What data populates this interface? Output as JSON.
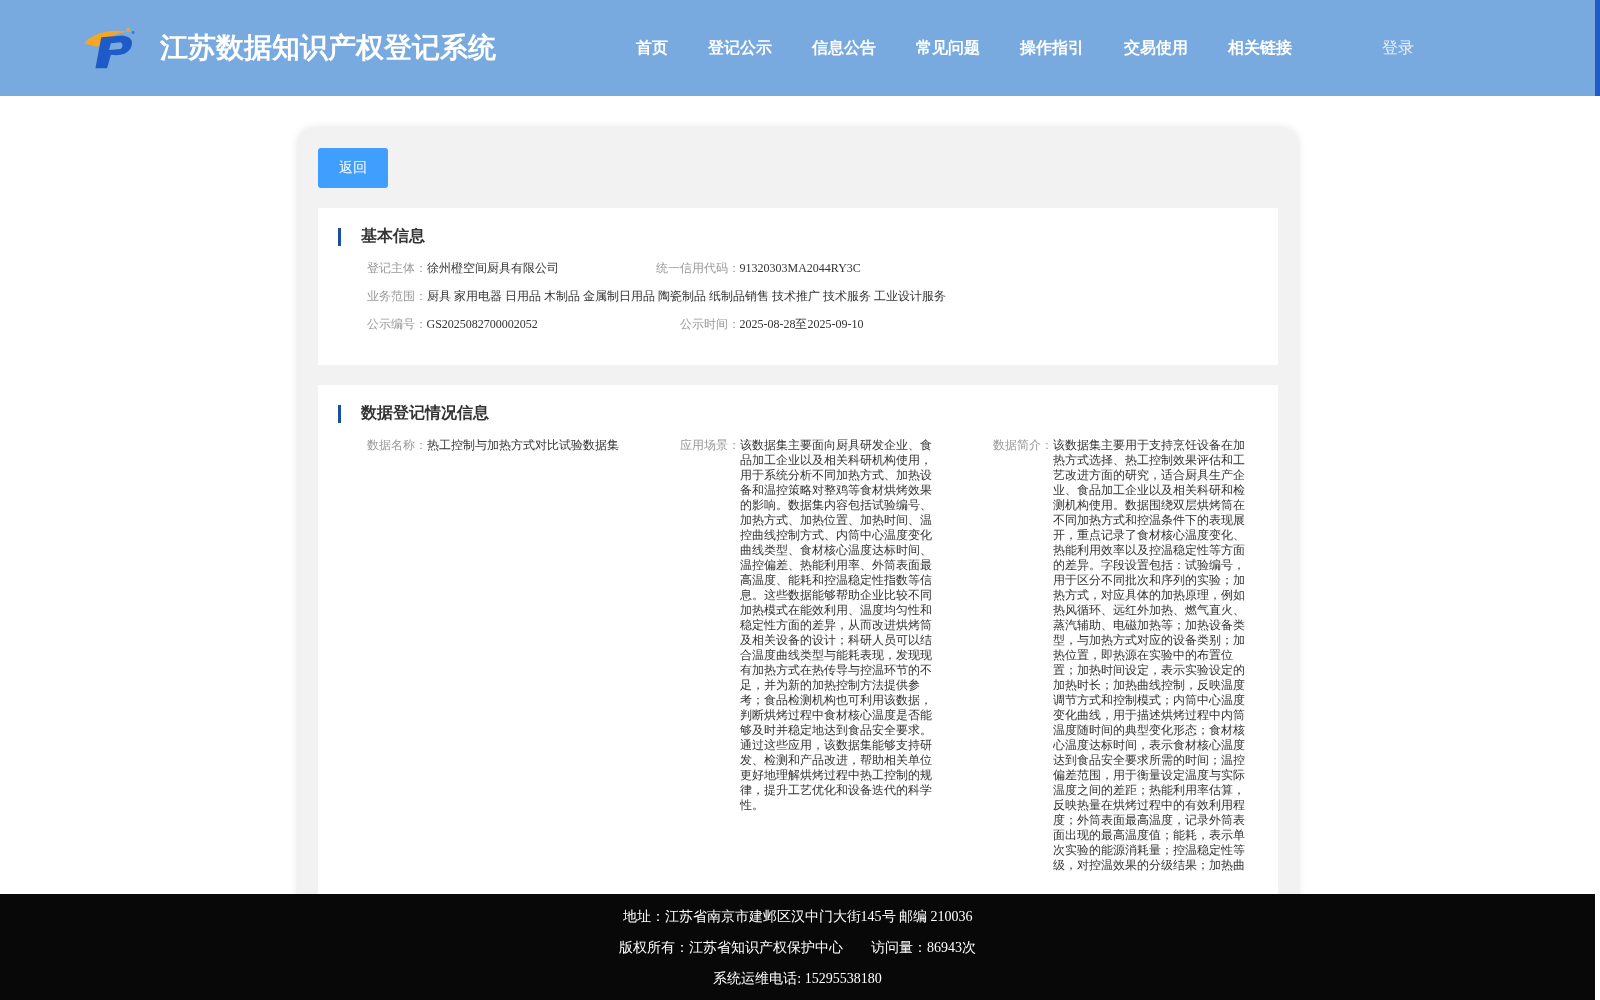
{
  "header": {
    "title": "江苏数据知识产权登记系统",
    "nav": [
      "首页",
      "登记公示",
      "信息公告",
      "常见问题",
      "操作指引",
      "交易使用",
      "相关链接"
    ],
    "login": "登录"
  },
  "back_button": "返回",
  "sections": [
    {
      "title": "基本信息",
      "rows": [
        [
          {
            "label": "登记主体：",
            "value": "徐州橙空间厨具有限公司"
          },
          {
            "label": "统一信用代码：",
            "value": "91320303MA2044RY3C"
          }
        ],
        [
          {
            "label": "业务范围：",
            "value": "厨具 家用电器 日用品 木制品 金属制日用品 陶瓷制品 纸制品销售 技术推广 技术服务 工业设计服务"
          }
        ],
        [
          {
            "label": "公示编号：",
            "value": "GS2025082700002052"
          },
          {
            "label": "公示时间：",
            "value": "2025-08-28至2025-09-10"
          }
        ]
      ]
    },
    {
      "title": "数据登记情况信息",
      "rows": [
        [
          {
            "label": "数据名称：",
            "value": "热工控制与加热方式对比试验数据集"
          },
          {
            "label": "应用场景：",
            "value": "该数据集主要面向厨具研发企业、食品加工企业以及相关科研机构使用，用于系统分析不同加热方式、加热设备和温控策略对整鸡等食材烘烤效果的影响。数据集内容包括试验编号、加热方式、加热位置、加热时间、温控曲线控制方式、内筒中心温度变化曲线类型、食材核心温度达标时间、温控偏差、热能利用率、外筒表面最高温度、能耗和控温稳定性指数等信息。这些数据能够帮助企业比较不同加热模式在能效利用、温度均匀性和稳定性方面的差异，从而改进烘烤筒及相关设备的设计；科研人员可以结合温度曲线类型与能耗表现，发现现有加热方式在热传导与控温环节的不足，并为新的加热控制方法提供参考；食品检测机构也可利用该数据，判断烘烤过程中食材核心温度是否能够及时并稳定地达到食品安全要求。通过这些应用，该数据集能够支持研发、检测和产品改进，帮助相关单位更好地理解烘烤过程中热工控制的规律，提升工艺优化和设备迭代的科学性。"
          },
          {
            "label": "数据简介：",
            "value": "该数据集主要用于支持烹饪设备在加热方式选择、热工控制效果评估和工艺改进方面的研究，适合厨具生产企业、食品加工企业以及相关科研和检测机构使用。数据围绕双层烘烤筒在不同加热方式和控温条件下的表现展开，重点记录了食材核心温度变化、热能利用效率以及控温稳定性等方面的差异。字段设置包括：试验编号，用于区分不同批次和序列的实验；加热方式，对应具体的加热原理，例如热风循环、远红外加热、燃气直火、蒸汽辅助、电磁加热等；加热设备类型，与加热方式对应的设备类别；加热位置，即热源在实验中的布置位置；加热时间设定，表示实验设定的加热时长；加热曲线控制，反映温度调节方式和控制模式；内筒中心温度变化曲线，用于描述烘烤过程中内筒温度随时间的典型变化形态；食材核心温度达标时间，表示食材核心温度达到食品安全要求所需的时间；温控偏差范围，用于衡量设定温度与实际温度之间的差距；热能利用率估算，反映热量在烘烤过程中的有效利用程度；外筒表面最高温度，记录外筒表面出现的最高温度值；能耗，表示单次实验的能源消耗量；控温稳定性等级，对控温效果的分级结果；加热曲"
          }
        ]
      ]
    }
  ],
  "footer": [
    "地址：江苏省南京市建邺区汉中门大街145号 邮编 210036",
    "版权所有：江苏省知识产权保护中心　　访问量：86943次",
    "系统运维电话: 15295538180"
  ]
}
